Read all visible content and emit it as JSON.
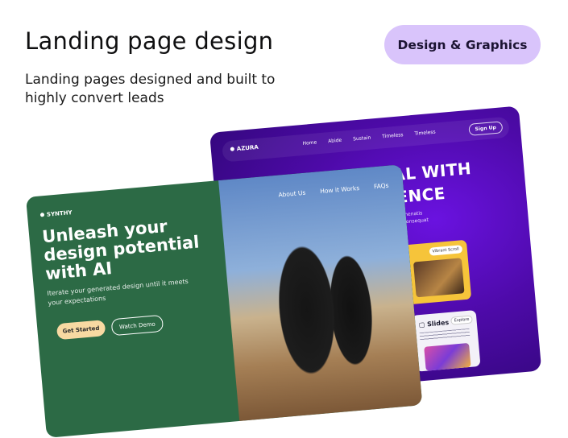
{
  "header": {
    "title": "Landing page design",
    "subtitle": "Landing pages designed and built to highly convert leads",
    "badge": "Design & Graphics"
  },
  "mockup_back": {
    "brand": "AZURA",
    "nav": [
      "Home",
      "Abide",
      "Sustain",
      "Timeless",
      "Timeless"
    ],
    "signup": "Sign Up",
    "headline_line1": "TIAL WITH",
    "headline_line2": "IGENCE",
    "body": "nim. Venenatis\nn cras consequat",
    "card_chip": "Vibrant Scroll",
    "slides_label": "Slides",
    "slides_chip": "Explore"
  },
  "mockup_front": {
    "brand": "SYNTHY",
    "nav": [
      "About Us",
      "How it Works",
      "FAQs"
    ],
    "headline": "Unleash your design potential with AI",
    "body": "Iterate your generated design until it meets your expectations",
    "primary_cta": "Get Started",
    "secondary_cta": "Watch Demo"
  },
  "colors": {
    "badge_bg": "#d9c4fb",
    "green": "#2c6a45",
    "purple": "#4d0aa8",
    "cta_bg": "#f8d9a2"
  }
}
